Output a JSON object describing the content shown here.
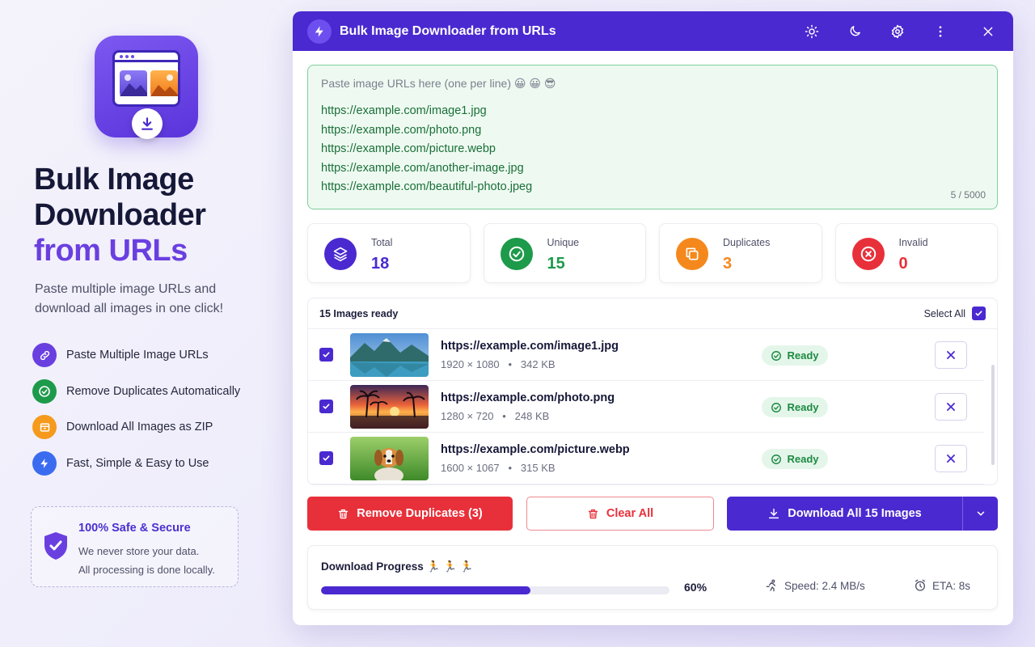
{
  "brand": {
    "title_line1": "Bulk Image",
    "title_line2": "Downloader",
    "title_accent": "from URLs",
    "subtitle": "Paste multiple image URLs and download all images in one click!"
  },
  "features": [
    {
      "label": "Paste Multiple Image URLs",
      "icon": "link-icon",
      "color": "#6a3fe0"
    },
    {
      "label": "Remove Duplicates Automatically",
      "icon": "check-circle-icon",
      "color": "#1d9a4a"
    },
    {
      "label": "Download All Images as ZIP",
      "icon": "zip-icon",
      "color": "#f59a1c"
    },
    {
      "label": "Fast, Simple & Easy to Use",
      "icon": "bolt-icon",
      "color": "#3b6cf0"
    }
  ],
  "secure": {
    "title": "100% Safe & Secure",
    "line1": "We never store your data.",
    "line2": "All processing is done locally."
  },
  "window": {
    "title": "Bulk Image Downloader from URLs"
  },
  "url_input": {
    "placeholder": "Paste image URLs here (one per line) 😀 😀 😎",
    "urls": [
      "https://example.com/image1.jpg",
      "https://example.com/photo.png",
      "https://example.com/picture.webp",
      "https://example.com/another-image.jpg",
      "https://example.com/beautiful-photo.jpeg"
    ],
    "count": "5 / 5000"
  },
  "stats": [
    {
      "label": "Total",
      "value": "18",
      "color": "#4a29d0",
      "icon": "layers-icon"
    },
    {
      "label": "Unique",
      "value": "15",
      "color": "#1d9a4a",
      "icon": "check-circle-icon"
    },
    {
      "label": "Duplicates",
      "value": "3",
      "color": "#f5881c",
      "icon": "copy-icon"
    },
    {
      "label": "Invalid",
      "value": "0",
      "color": "#e8303a",
      "icon": "x-circle-icon"
    }
  ],
  "list": {
    "title": "15 Images ready",
    "select_all": "Select All",
    "rows": [
      {
        "url": "https://example.com/image1.jpg",
        "dims": "1920 × 1080",
        "size": "342 KB",
        "status": "Ready"
      },
      {
        "url": "https://example.com/photo.png",
        "dims": "1280 × 720",
        "size": "248 KB",
        "status": "Ready"
      },
      {
        "url": "https://example.com/picture.webp",
        "dims": "1600 × 1067",
        "size": "315 KB",
        "status": "Ready"
      }
    ]
  },
  "actions": {
    "remove_duplicates": "Remove Duplicates (3)",
    "clear_all": "Clear All",
    "download_all": "Download All 15 Images"
  },
  "progress": {
    "title": "Download Progress 🏃 🏃 🏃",
    "percent": 60,
    "percent_label": "60%",
    "speed": "Speed: 2.4 MB/s",
    "eta": "ETA: 8s"
  },
  "colors": {
    "primary": "#4a29d0",
    "accent": "#6a3fe0",
    "success": "#1d9a4a",
    "danger": "#e8303a",
    "warning": "#f5881c"
  }
}
